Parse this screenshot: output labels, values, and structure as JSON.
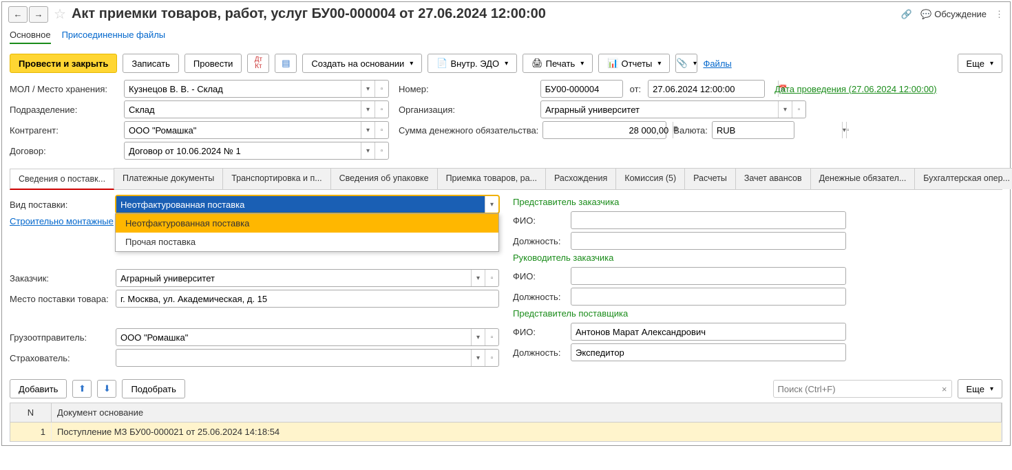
{
  "header": {
    "title": "Акт приемки товаров, работ, услуг БУ00-000004 от 27.06.2024 12:00:00",
    "discussion": "Обсуждение"
  },
  "linkrow": {
    "main": "Основное",
    "files": "Присоединенные файлы"
  },
  "toolbar": {
    "post_close": "Провести и закрыть",
    "save": "Записать",
    "post": "Провести",
    "create_from": "Создать на основании",
    "edo": "Внутр. ЭДО",
    "print": "Печать",
    "reports": "Отчеты",
    "files": "Файлы",
    "more": "Еще"
  },
  "fields": {
    "mol_lbl": "МОЛ / Место хранения:",
    "mol_val": "Кузнецов В. В. - Склад",
    "num_lbl": "Номер:",
    "num_val": "БУ00-000004",
    "ot_lbl": "от:",
    "date_val": "27.06.2024 12:00:00",
    "date_posted": "Дата проведения (27.06.2024 12:00:00)",
    "subdiv_lbl": "Подразделение:",
    "subdiv_val": "Склад",
    "org_lbl": "Организация:",
    "org_val": "Аграрный университет",
    "contr_lbl": "Контрагент:",
    "contr_val": "ООО \"Ромашка\"",
    "sum_lbl": "Сумма денежного обязательства:",
    "sum_val": "28 000,00",
    "curr_lbl": "Валюта:",
    "curr_val": "RUB",
    "dog_lbl": "Договор:",
    "dog_val": "Договор от 10.06.2024 № 1"
  },
  "tabs": {
    "t1": "Сведения о поставк...",
    "t2": "Платежные документы",
    "t3": "Транспортировка и п...",
    "t4": "Сведения об упаковке",
    "t5": "Приемка товаров, ра...",
    "t6": "Расхождения",
    "t7": "Комиссия (5)",
    "t8": "Расчеты",
    "t9": "Зачет авансов",
    "t10": "Денежные обязател...",
    "t11": "Бухгалтерская опер..."
  },
  "delivery": {
    "type_lbl": "Вид поставки:",
    "type_val": "Неотфактурованная поставка",
    "smr_link": "Строительно монтажные",
    "options": [
      "Неотфактурованная поставка",
      "Прочая поставка"
    ],
    "cust_rep_h": "Представитель заказчика",
    "fio_lbl": "ФИО:",
    "pos_lbl": "Должность:",
    "cust_head_h": "Руководитель заказчика",
    "cust_lbl": "Заказчик:",
    "cust_val": "Аграрный университет",
    "place_lbl": "Место поставки товара:",
    "place_val": "г. Москва, ул. Академическая, д. 15",
    "sup_rep_h": "Представитель поставщика",
    "sup_fio_val": "Антонов Марат Александрович",
    "sup_pos_val": "Экспедитор",
    "sender_lbl": "Грузоотправитель:",
    "sender_val": "ООО \"Ромашка\"",
    "ins_lbl": "Страхователь:"
  },
  "subbar": {
    "add": "Добавить",
    "pick": "Подобрать",
    "search_ph": "Поиск (Ctrl+F)",
    "more": "Еще"
  },
  "table": {
    "h_n": "N",
    "h_doc": "Документ основание",
    "r1_n": "1",
    "r1_doc": "Поступление МЗ БУ00-000021 от 25.06.2024 14:18:54"
  }
}
